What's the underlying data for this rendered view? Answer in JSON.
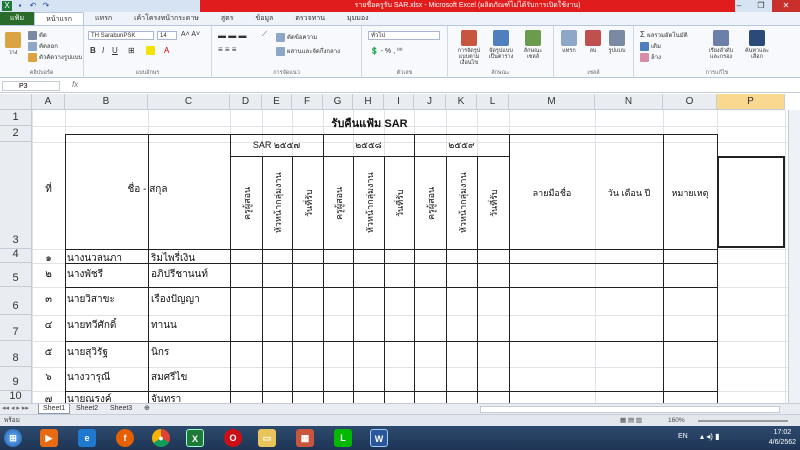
{
  "window": {
    "title": "รายชื่อครูรับ SAR.xlsx - Microsoft Excel (ผลิตภัณฑ์ไม่ได้รับการเปิดใช้งาน)",
    "qa_icons": [
      "excel-icon",
      "save-icon",
      "undo-icon",
      "redo-icon"
    ],
    "buttons": {
      "minimize": "–",
      "restore": "❐",
      "close": "✕"
    }
  },
  "tabs": [
    "แฟ้ม",
    "หน้าแรก",
    "แทรก",
    "เค้าโครงหน้ากระดาษ",
    "สูตร",
    "ข้อมูล",
    "ตรวจทาน",
    "มุมมอง"
  ],
  "ribbon": {
    "clipboard": {
      "paste": "วาง",
      "cut": "ตัด",
      "copy": "คัดลอก",
      "format_painter": "ตัวคัดวางรูปแบบ",
      "label": "คลิปบอร์ด"
    },
    "font": {
      "name": "TH SarabunPSK",
      "size": "14",
      "label": "แบบอักษร"
    },
    "alignment": {
      "wrap": "ตัดข้อความ",
      "merge": "ผสานและจัดกึ่งกลาง",
      "label": "การจัดแนว"
    },
    "number": {
      "format": "ทั่วไป",
      "label": "ตัวเลข"
    },
    "styles": {
      "conditional": "การจัดรูปแบบตามเงื่อนไข",
      "table": "จัดรูปแบบเป็นตาราง",
      "cell": "ลักษณะเซลล์",
      "label": "ลักษณะ"
    },
    "cells": {
      "insert": "แทรก",
      "delete": "ลบ",
      "format": "รูปแบบ",
      "label": "เซลล์"
    },
    "editing": {
      "autosum": "ผลรวมอัตโนมัติ",
      "fill": "เติม",
      "clear": "ล้าง",
      "sort": "เรียงลำดับและกรอง",
      "find": "ค้นหาและเลือก",
      "label": "การแก้ไข"
    }
  },
  "formula_bar": {
    "name_box": "P3",
    "fx": "fx",
    "value": ""
  },
  "columns": [
    "A",
    "B",
    "C",
    "D",
    "E",
    "F",
    "G",
    "H",
    "I",
    "J",
    "K",
    "L",
    "M",
    "N",
    "O",
    "P"
  ],
  "rows": [
    "1",
    "2",
    "3",
    "4",
    "5",
    "6",
    "7",
    "8",
    "9",
    "10"
  ],
  "sheet": {
    "title": "รับคืนแฟ้ม SAR",
    "group_headers": [
      "SAR ๒๕๕๗",
      "๒๕๕๘",
      "๒๕๕๙"
    ],
    "col_headers": {
      "no": "ที่",
      "name": "ชื่อ - สกุล",
      "sub": [
        "ครูผู้สอน",
        "หัวหน้ากลุ่มงาน",
        "วันที่รับ",
        "ครูผู้สอน",
        "หัวหน้ากลุ่มงาน",
        "วันที่รับ",
        "ครูผู้สอน",
        "หัวหน้ากลุ่มงาน",
        "วันที่รับ"
      ],
      "signature": "ลายมือชื่อ",
      "date": "วัน เดือน ปี",
      "note": "หมายเหตุ"
    },
    "people": [
      {
        "no": "๑",
        "first": "นางนวลนภา",
        "last": "ริมไพรี่เงิน"
      },
      {
        "no": "๒",
        "first": "นางพัชรี",
        "last": "อภิปรีชานนท์"
      },
      {
        "no": "๓",
        "first": "นายวิสาขะ",
        "last": "เรืองปัญญา"
      },
      {
        "no": "๔",
        "first": "นายทวีศักดิ์",
        "last": "ทานน"
      },
      {
        "no": "๕",
        "first": "นายสุวิรัฐ",
        "last": "นิกร"
      },
      {
        "no": "๖",
        "first": "นางวารุณี",
        "last": "สมศรีไข"
      },
      {
        "no": "๗",
        "first": "นายณรงค์",
        "last": "จันทรา"
      }
    ]
  },
  "sheet_tabs": [
    "Sheet1",
    "Sheet2",
    "Sheet3"
  ],
  "status": {
    "mode": "พร้อม",
    "zoom": "160%"
  },
  "taskbar": {
    "apps": [
      "start-orb-icon",
      "media-player-icon",
      "ie-icon",
      "firefox-icon",
      "chrome-icon",
      "excel-icon",
      "opera-icon",
      "folder-icon",
      "calendar-app-icon",
      "line-icon",
      "word-icon"
    ],
    "lang": "EN",
    "time": "17:02",
    "date": "4/6/2562"
  }
}
